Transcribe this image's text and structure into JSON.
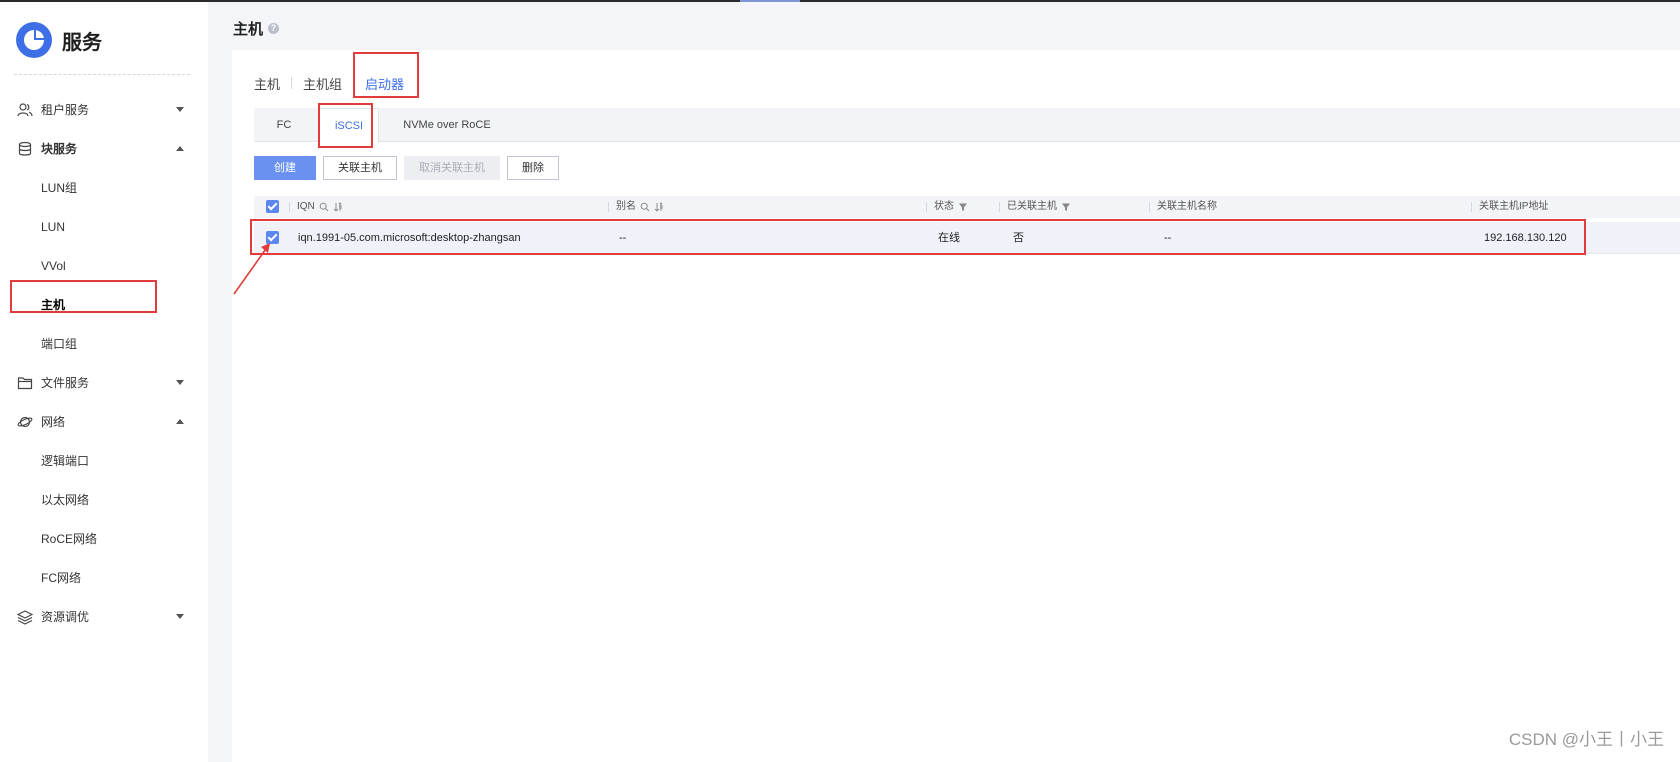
{
  "brand": {
    "title": "服务"
  },
  "nav": {
    "items": [
      {
        "label": "租户服务",
        "icon": "users-icon",
        "arrow": "down"
      },
      {
        "label": "块服务",
        "icon": "database-icon",
        "arrow": "up"
      },
      {
        "label": "LUN组"
      },
      {
        "label": "LUN"
      },
      {
        "label": "VVol"
      },
      {
        "label": "主机"
      },
      {
        "label": "端口组"
      },
      {
        "label": "文件服务",
        "icon": "folder-icon",
        "arrow": "down"
      },
      {
        "label": "网络",
        "icon": "planet-icon",
        "arrow": "up"
      },
      {
        "label": "逻辑端口"
      },
      {
        "label": "以太网络"
      },
      {
        "label": "RoCE网络"
      },
      {
        "label": "FC网络"
      },
      {
        "label": "资源调优",
        "icon": "layers-icon",
        "arrow": "down"
      }
    ]
  },
  "page": {
    "title": "主机",
    "help": "?"
  },
  "tabs": [
    {
      "label": "主机"
    },
    {
      "label": "主机组"
    },
    {
      "label": "启动器"
    }
  ],
  "subtabs": [
    {
      "label": "FC"
    },
    {
      "label": "iSCSI"
    },
    {
      "label": "NVMe over RoCE"
    }
  ],
  "toolbar": {
    "create": "创建",
    "associate": "关联主机",
    "disassociate": "取消关联主机",
    "delete": "删除"
  },
  "table": {
    "headers": {
      "iqn": "IQN",
      "alias": "别名",
      "status": "状态",
      "associated": "已关联主机",
      "host_name": "关联主机名称",
      "host_ip": "关联主机IP地址"
    },
    "rows": [
      {
        "iqn": "iqn.1991-05.com.microsoft:desktop-zhangsan",
        "alias": "--",
        "status": "在线",
        "associated": "否",
        "host_name": "--",
        "host_ip": "192.168.130.120"
      }
    ]
  },
  "watermark": "CSDN @小王丨小王",
  "colors": {
    "accent": "#3d6ee8",
    "primary_button": "#6b91f0",
    "highlight": "#e23b3b",
    "logo": "#3f6fe6"
  }
}
